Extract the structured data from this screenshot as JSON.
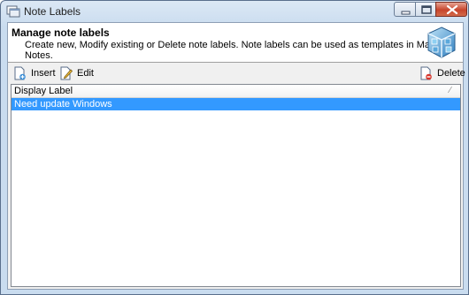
{
  "window": {
    "title": "Note Labels",
    "controls": {
      "minimize": "minimize-icon",
      "maximize": "maximize-icon",
      "close": "close-icon"
    }
  },
  "header": {
    "title": "Manage note labels",
    "description": "Create new, Modify existing or Delete note labels. Note labels can be used as templates in Machine Notes."
  },
  "toolbar": {
    "insert_label": "Insert",
    "edit_label": "Edit",
    "delete_label": "Delete"
  },
  "grid": {
    "columns": [
      "Display Label"
    ],
    "rows": [
      {
        "label": "Need update Windows",
        "selected": true
      }
    ]
  },
  "colors": {
    "selection": "#3399ff",
    "client_bg": "#f0f0f0"
  }
}
